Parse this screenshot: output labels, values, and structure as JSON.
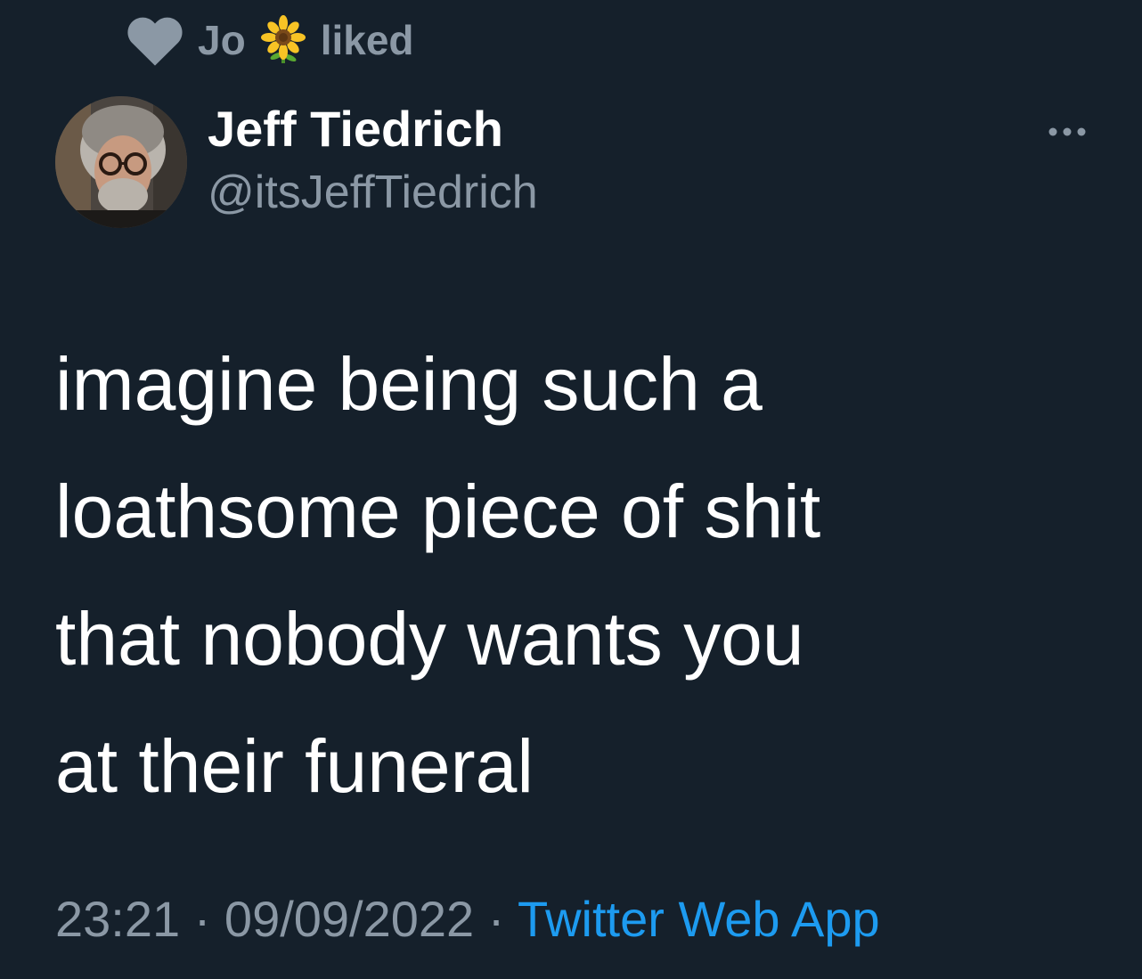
{
  "social_context": {
    "user_name": "Jo",
    "user_emoji": "sunflower-emoji",
    "action": "liked",
    "icon": "heart-icon"
  },
  "author": {
    "display_name": "Jeff Tiedrich",
    "handle": "@itsJeffTiedrich",
    "avatar": "avatar-photo"
  },
  "more_icon": "more-horizontal-icon",
  "tweet": {
    "lines": [
      "imagine being such a",
      "loathsome piece of shit",
      "that nobody wants you",
      "at their funeral"
    ]
  },
  "meta": {
    "time": "23:21",
    "separator": "·",
    "date": "09/09/2022",
    "source": "Twitter Web App"
  },
  "colors": {
    "background": "#15202b",
    "primary_text": "#ffffff",
    "secondary_text": "#8b98a5",
    "link": "#1d9bf0"
  }
}
